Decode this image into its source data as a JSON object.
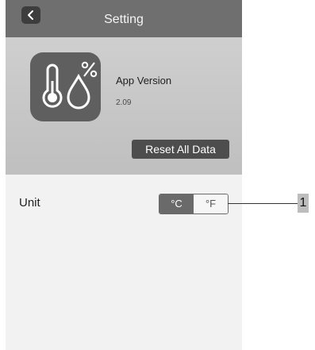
{
  "header": {
    "title": "Setting",
    "back_icon": "chevron-left-icon"
  },
  "app": {
    "icon": "thermometer-humidity-icon",
    "version_label": "App Version",
    "version_value": "2.09",
    "reset_label": "Reset All Data"
  },
  "unit": {
    "label": "Unit",
    "options": [
      "°C",
      "°F"
    ],
    "selected": "°C"
  },
  "callout": {
    "number": "1"
  },
  "colors": {
    "nav_bar": "#6f6f6f",
    "panel": "#c8c8c8",
    "button_dark": "#4d4d4d",
    "active_segment": "#6a6a6a"
  }
}
